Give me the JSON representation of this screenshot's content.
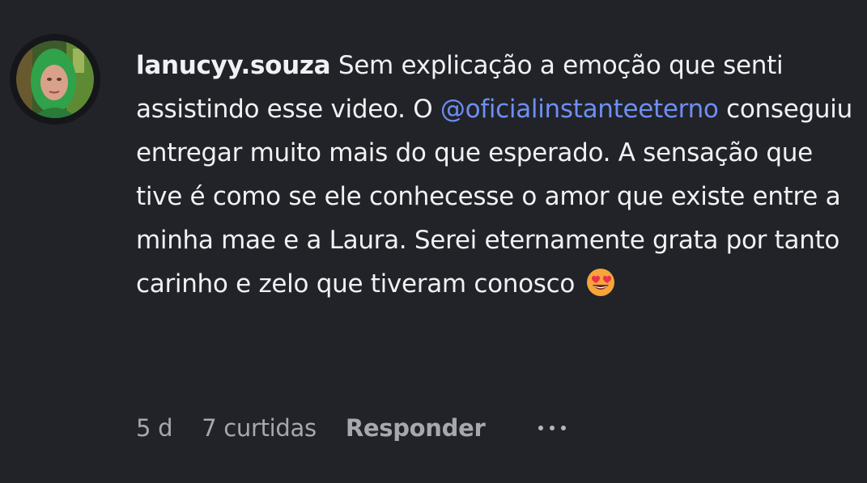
{
  "comment": {
    "username": "lanucyy.souza",
    "text_before_mention": " Sem explicação a emoção que senti assistindo esse video. O ",
    "mention": "@oficialinstanteeterno",
    "text_after_mention": " conseguiu entregar muito mais do que esperado. A sensação que tive é como se ele conhecesse o amor que existe entre a minha mae e a Laura. Serei eternamente grata por tanto carinho e zelo que tiveram conosco ",
    "emoji": "smiling-face-with-heart-eyes"
  },
  "actions": {
    "time": "5 d",
    "likes": "7 curtidas",
    "reply": "Responder",
    "more_icon": "more-horizontal-icon"
  },
  "colors": {
    "background": "#212328",
    "text": "#f1f1f3",
    "mention": "#6e8ef5",
    "muted": "#a6a8b0"
  }
}
